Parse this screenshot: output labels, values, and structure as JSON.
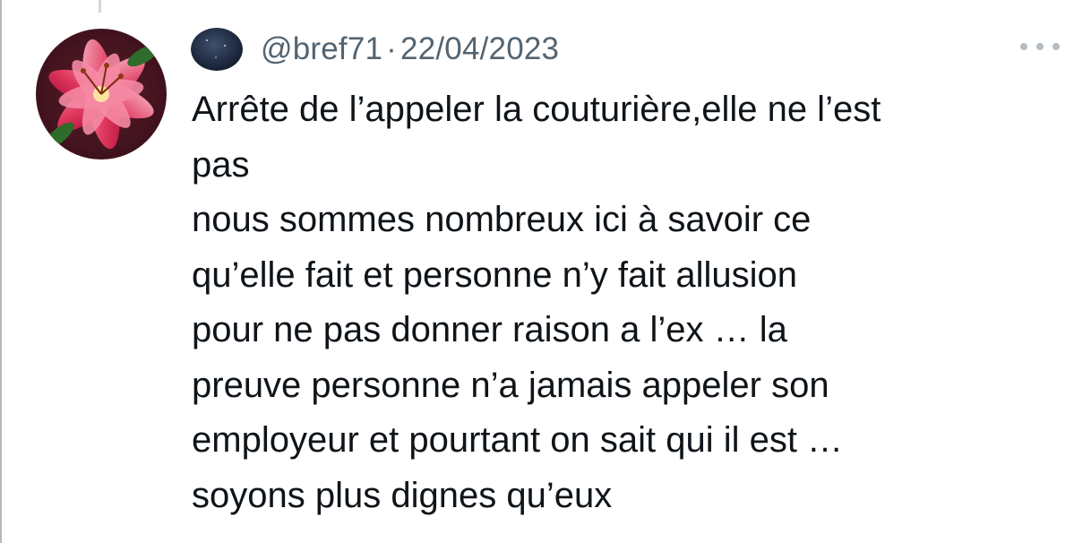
{
  "tweet": {
    "handle": "@bref71",
    "separator": "·",
    "date": "22/04/2023",
    "lines": [
      "Arrête de l’appeler la couturière,elle ne l’est",
      "pas",
      "nous sommes nombreux ici à savoir ce",
      "qu’elle fait et personne n’y fait allusion",
      "pour ne pas donner raison a l’ex … la",
      "preuve personne n’a jamais appeler son",
      "employeur et pourtant on sait qui il est …",
      "soyons plus dignes qu’eux"
    ]
  },
  "icons": {
    "avatar": "lily-flower-avatar",
    "mini_avatar": "dark-night-sky-avatar",
    "more": "more-options-icon"
  },
  "colors": {
    "text": "#0f1419",
    "secondary": "#536471",
    "dots": "#b3bcc3"
  }
}
